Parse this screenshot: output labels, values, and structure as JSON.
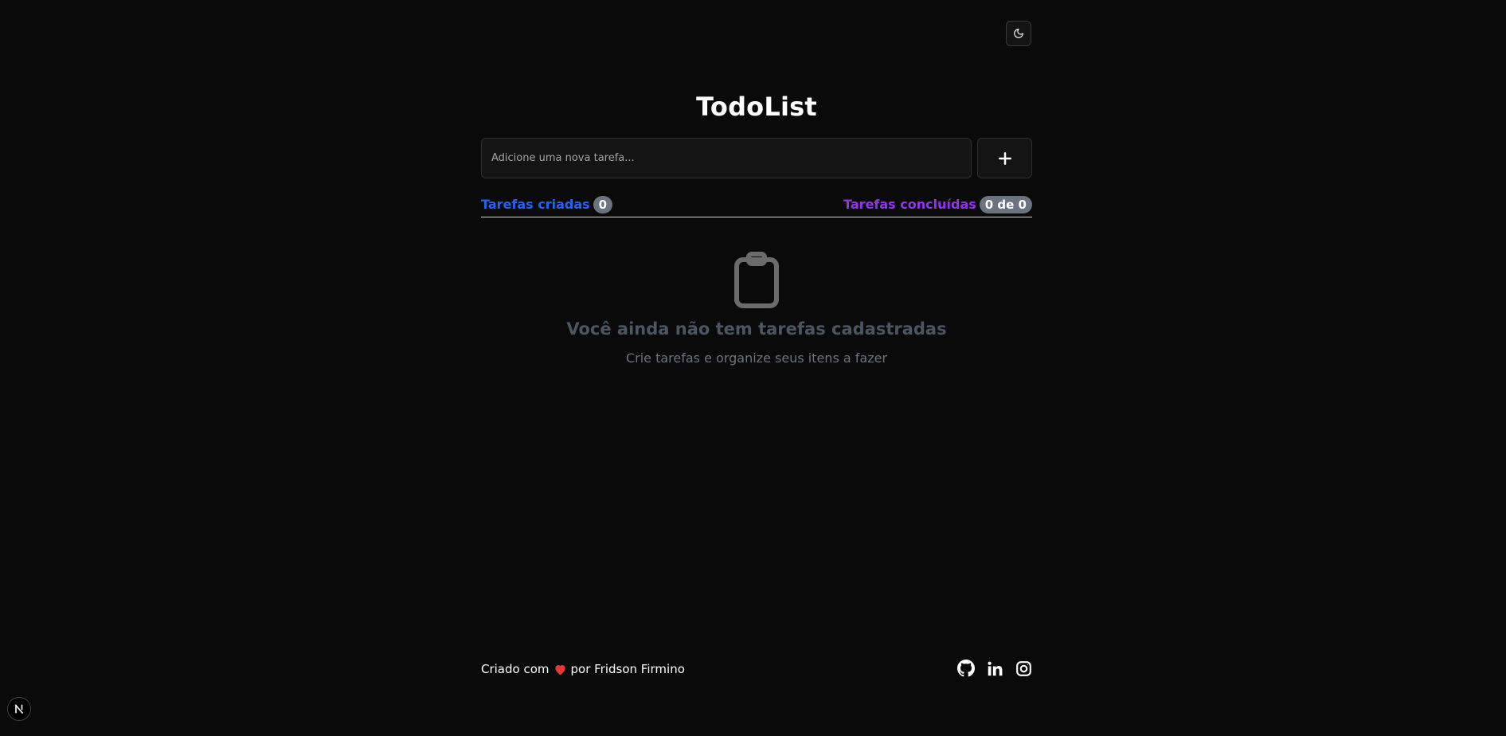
{
  "header": {
    "title": "TodoList",
    "theme_toggle_icon": "moon-icon"
  },
  "task_form": {
    "input_value": "",
    "input_placeholder": "Adicione uma nova tarefa...",
    "add_button_icon": "plus-icon"
  },
  "stats": {
    "created_label": "Tarefas criadas",
    "created_count": "0",
    "completed_label": "Tarefas concluídas",
    "completed_count": "0 de 0",
    "created_color": "#2563eb",
    "completed_color": "#9333ea"
  },
  "empty_state": {
    "icon": "clipboard-icon",
    "title": "Você ainda não tem tarefas cadastradas",
    "subtitle": "Crie tarefas e organize seus itens a fazer"
  },
  "footer": {
    "text_before": "Criado com",
    "heart_icon": "heart-icon",
    "text_after": "por Fridson Firmino",
    "social_icons": [
      "github-icon",
      "linkedin-icon",
      "instagram-icon"
    ]
  },
  "dev_badge": {
    "label": "N"
  },
  "colors": {
    "background": "#0a0a0a",
    "badge": "#6b7280",
    "empty_title": "#4b5563",
    "heart": "#e53935"
  }
}
